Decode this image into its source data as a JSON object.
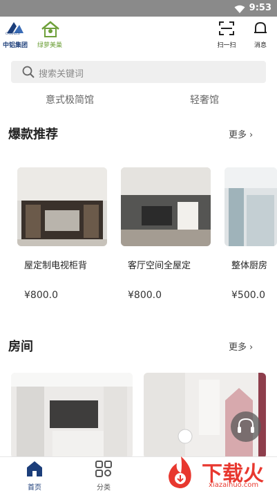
{
  "status_bar": {
    "time": "9:53",
    "wifi_icon": "wifi-icon"
  },
  "header": {
    "logo1_name": "中铝集团",
    "logo1_abbr": "CHINALCO",
    "logo2_name": "绿萝美巢",
    "scan_label": "扫一扫",
    "message_label": "消息"
  },
  "search": {
    "placeholder": "搜索关键词"
  },
  "category_tabs": [
    "意式极简馆",
    "轻奢馆"
  ],
  "hot_section": {
    "title": "爆款推荐",
    "more_label": "更多",
    "products": [
      {
        "name": "屋定制电视柜背",
        "price": "¥800.0"
      },
      {
        "name": "客厅空间全屋定",
        "price": "¥800.0"
      },
      {
        "name": "整体厨房",
        "price": "¥500.0"
      }
    ]
  },
  "room_section": {
    "title": "房间",
    "more_label": "更多"
  },
  "tabbar": {
    "home_label": "首页",
    "category_label": "分类"
  },
  "watermark": {
    "text": "下载火",
    "url": "xiazaihuo.com"
  },
  "colors": {
    "brand": "#1c3e7a",
    "accent_green": "#6ea03a",
    "watermark_red": "#e8382f"
  }
}
